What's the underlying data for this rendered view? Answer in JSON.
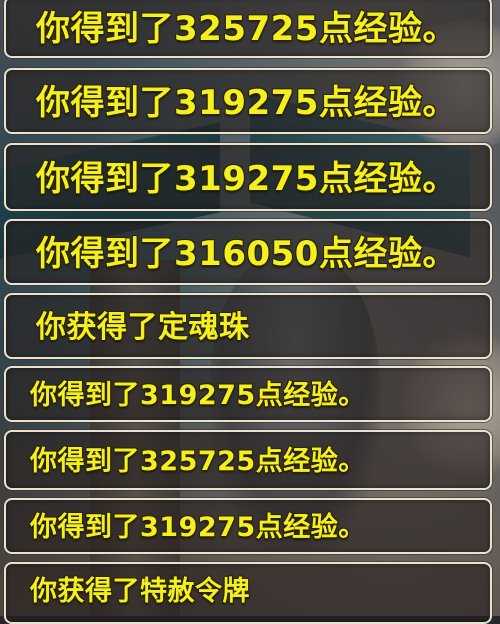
{
  "message_log": {
    "messages": [
      {
        "text": "你得到了325725点经验。"
      },
      {
        "text": "你得到了319275点经验。"
      },
      {
        "text": "你得到了319275点经验。"
      },
      {
        "text": "你得到了316050点经验。"
      },
      {
        "text": "你获得了定魂珠"
      },
      {
        "text": "你得到了319275点经验。"
      },
      {
        "text": "你得到了325725点经验。"
      },
      {
        "text": "你得到了319275点经验。"
      },
      {
        "text": "你获得了特赦令牌"
      }
    ]
  },
  "colors": {
    "message_text": "#f4f020",
    "message_border": "#e8e2cf",
    "message_background": "#26211f"
  }
}
